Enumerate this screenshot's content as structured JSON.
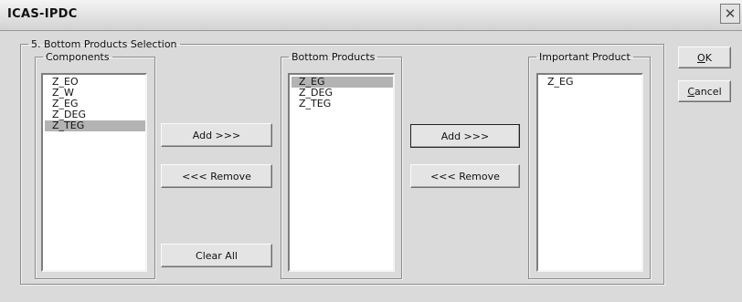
{
  "window": {
    "title": "ICAS-IPDC",
    "close_glyph": "✕"
  },
  "dialog": {
    "section_title": "5. Bottom Products Selection",
    "components": {
      "label": "Components",
      "items": [
        "Z_EO",
        "Z_W",
        "Z_EG",
        "Z_DEG",
        "Z_TEG"
      ],
      "selected_index": 4
    },
    "bottom_products": {
      "label": "Bottom Products",
      "items": [
        "Z_EG",
        "Z_DEG",
        "Z_TEG"
      ],
      "selected_index": 0
    },
    "important_product": {
      "label": "Important Product",
      "items": [
        "Z_EG"
      ]
    },
    "buttons": {
      "add_left": "Add >>>",
      "remove_left": "<<< Remove",
      "clear_all": "Clear All",
      "add_right": "Add >>>",
      "remove_right": "<<< Remove",
      "ok_mnemonic": "O",
      "ok_rest": "K",
      "cancel_mnemonic": "C",
      "cancel_rest": "ancel"
    }
  }
}
